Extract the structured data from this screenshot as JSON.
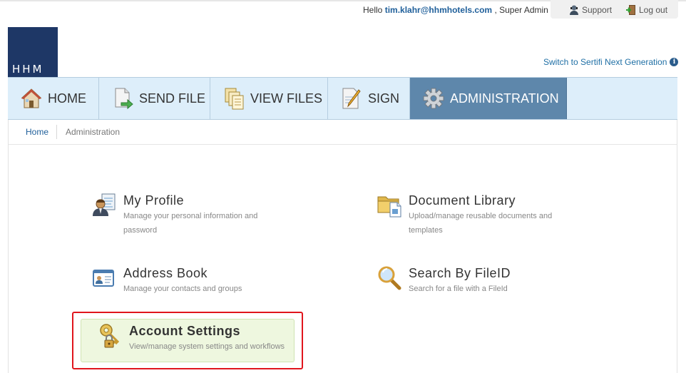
{
  "user_bar": {
    "hello": "Hello",
    "email": "tim.klahr@hhmhotels.com",
    "role": ", Super Admin",
    "support_label": "Support",
    "logout_label": "Log out"
  },
  "logo": {
    "text": "HHM"
  },
  "switch_link": "Switch to Sertifi Next Generation",
  "nav": {
    "tabs": [
      {
        "label": "HOME",
        "icon": "home-icon"
      },
      {
        "label": "SEND FILE",
        "icon": "send-file-icon"
      },
      {
        "label": "VIEW FILES",
        "icon": "view-files-icon"
      },
      {
        "label": "SIGN",
        "icon": "sign-icon"
      },
      {
        "label": "ADMINISTRATION",
        "icon": "gear-icon",
        "active": true
      }
    ]
  },
  "breadcrumb": {
    "home": "Home",
    "current": "Administration"
  },
  "admin_items": [
    {
      "title": "My Profile",
      "desc_line1": "Manage your personal information and",
      "desc_line2": "password",
      "icon": "profile-icon"
    },
    {
      "title": "Document Library",
      "desc_line1": "Upload/manage reusable documents and",
      "desc_line2": "templates",
      "icon": "folder-icon"
    },
    {
      "title": "Address Book",
      "desc_line1": "Manage your contacts and groups",
      "icon": "address-book-icon"
    },
    {
      "title": "Search By FileID",
      "desc_line1": "Search for a file with a FileId",
      "icon": "magnifier-icon"
    },
    {
      "title": "Account Settings",
      "desc_line1": "View/manage system settings and workflows",
      "icon": "key-lock-icon",
      "highlighted": true
    }
  ],
  "colors": {
    "nav_bg": "#ddeefa",
    "nav_active": "#5e87ab",
    "logo_bg": "#1e3766",
    "highlight_border": "#e0151d",
    "link": "#1f5f9a"
  }
}
